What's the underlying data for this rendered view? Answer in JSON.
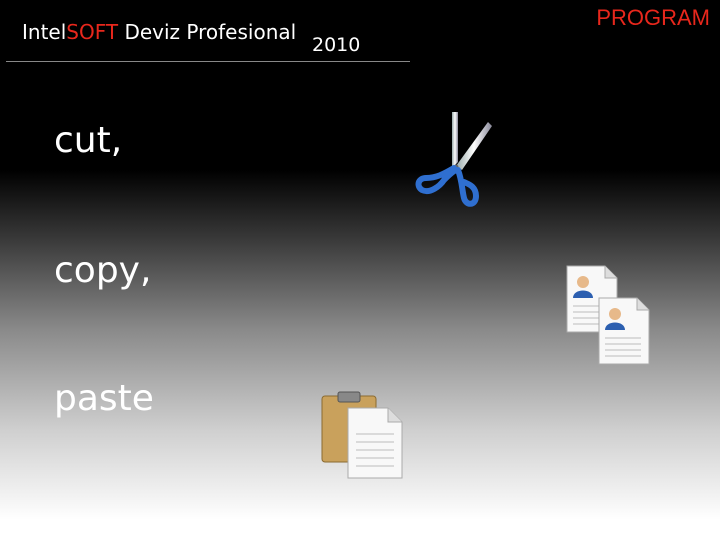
{
  "header": {
    "brand_intel": "Intel",
    "brand_soft": "SOFT",
    "product": "Deviz Profesional",
    "year": "2010",
    "program": "PROGRAM"
  },
  "words": {
    "cut": "cut,",
    "copy": "copy,",
    "paste": "paste"
  },
  "icons": {
    "cut": "scissors-icon",
    "copy": "copy-documents-icon",
    "paste": "clipboard-paste-icon"
  },
  "colors": {
    "accent": "#e8271c",
    "text": "#ffffff"
  }
}
